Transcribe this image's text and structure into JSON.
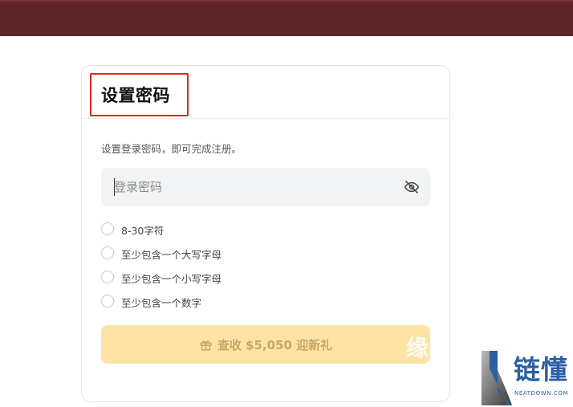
{
  "header": {
    "title": "设置密码"
  },
  "form": {
    "description": "设置登录密码，即可完成注册。",
    "password_placeholder": "登录密码",
    "rules": [
      "8-30字符",
      "至少包含一个大写字母",
      "至少包含一个小写字母",
      "至少包含一个数字"
    ],
    "submit_label": "查收 $5,050 迎新礼"
  },
  "watermark": {
    "char": "缘",
    "logo_text": "链懂",
    "logo_sub": "NEATDOWN.COM"
  },
  "colors": {
    "topbar": "#5e2526",
    "highlight": "#e52420",
    "button_bg": "#fde4a6",
    "button_text": "#c9a764",
    "logo": "#2c5fa3"
  },
  "icons": {
    "visibility_toggle": "eye-off-icon",
    "button_icon": "gift-icon"
  }
}
